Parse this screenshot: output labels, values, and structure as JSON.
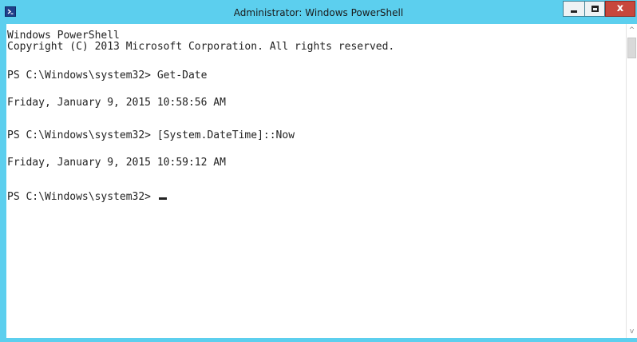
{
  "window": {
    "title": "Administrator: Windows PowerShell",
    "accent_color": "#5ccfee",
    "close_color": "#c7473c",
    "controls": {
      "minimize": "minimize-icon",
      "maximize": "maximize-icon",
      "close_label": "x"
    }
  },
  "console": {
    "lines": [
      "Windows PowerShell",
      "Copyright (C) 2013 Microsoft Corporation. All rights reserved.",
      "",
      "PS C:\\Windows\\system32> Get-Date",
      "",
      "Friday, January 9, 2015 10:58:56 AM",
      "",
      "",
      "PS C:\\Windows\\system32> [System.DateTime]::Now",
      "",
      "Friday, January 9, 2015 10:59:12 AM",
      "",
      "",
      "PS C:\\Windows\\system32> "
    ]
  },
  "scrollbar": {
    "up": "^",
    "down": "v"
  }
}
